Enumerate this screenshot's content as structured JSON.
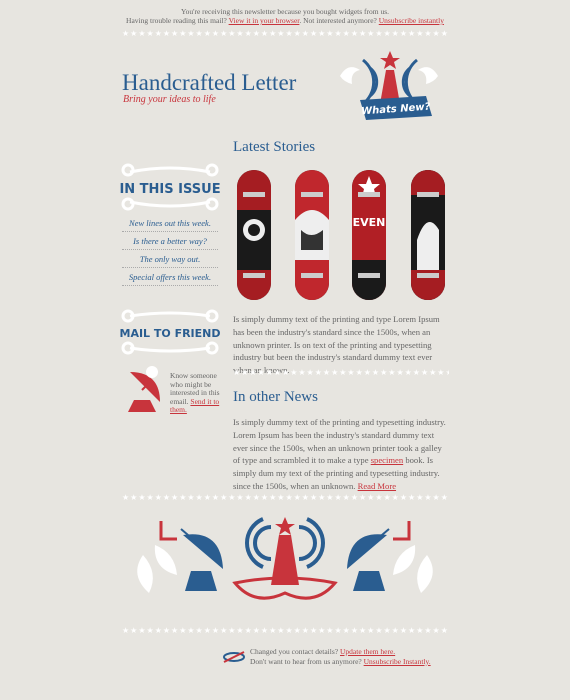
{
  "preheader": {
    "line1": "You're receiving this newsletter because you bought widgets from us.",
    "line2_text": "Having trouble reading this mail?",
    "line2_link": "View it in your browser",
    "line2_text2": "Not interested anymore?",
    "line2_link2": "Unsubscribe instantly"
  },
  "header": {
    "title": "Handcrafted Letter",
    "subtitle": "Bring your ideas to life",
    "badge": "Whats New?"
  },
  "sidebar": {
    "in_this_issue": "IN THIS ISSUE",
    "items": [
      {
        "label": "New lines out this week."
      },
      {
        "label": "Is there a better way?"
      },
      {
        "label": "The only way out."
      },
      {
        "label": "Special offers this week."
      }
    ],
    "mail_to_friend": "MAIL TO FRIEND",
    "know_someone": "Know someone who might be interested in this email.",
    "send_link": "Send it to them."
  },
  "latest": {
    "heading": "Latest Stories",
    "board_text": "EVEN",
    "body": "Is simply dummy text of the printing and type Lorem Ipsum has been the industry's standard  since the 1500s, when an unknown printer. Is on text of the printing and typesetting industry but been the industry's standard dummy text ever  when an known."
  },
  "other": {
    "heading": "In other News",
    "body1": "Is simply dummy text of the printing and typesetting industry. Lorem Ipsum has been the industry's standard dummy text ever since the 1500s, when an unknown printer took a galley of type and scrambled it to make a type",
    "link1": "specimen",
    "body2": "book. Is simply dum my text of the printing and typesetting industry. since the 1500s, when an unknown.",
    "read_more": "Read More"
  },
  "footer": {
    "line1_text": "Changed you contact details?",
    "line1_link": "Update them here.",
    "line2_text": "Don't want to hear from us anymore?",
    "line2_link": "Unsubscribe Instantly."
  },
  "colors": {
    "blue": "#2a5d90",
    "red": "#c8343c",
    "background": "#e7e5e0"
  }
}
